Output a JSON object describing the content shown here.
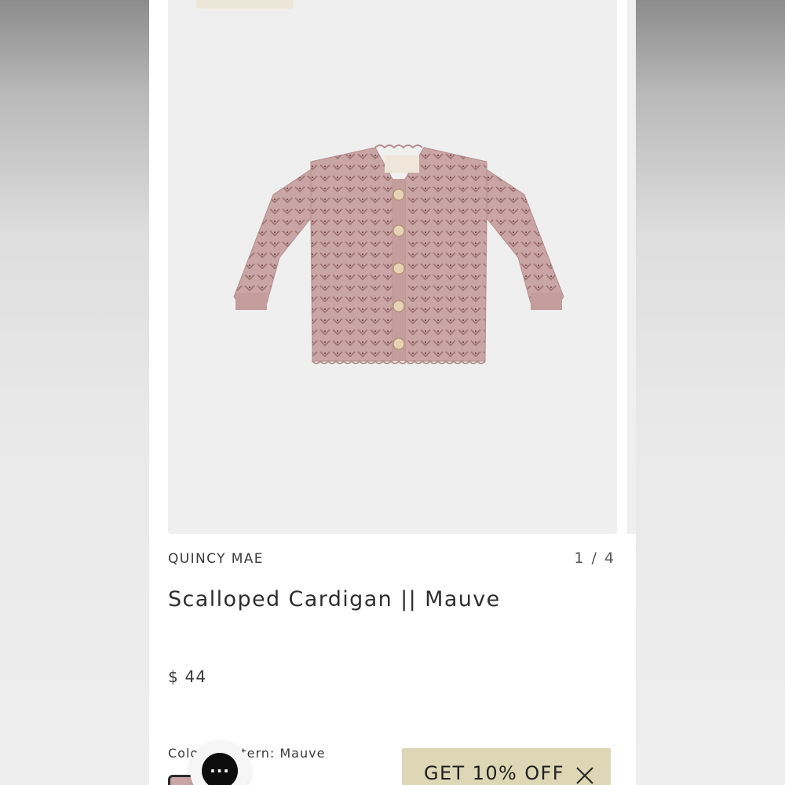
{
  "product": {
    "brand": "QUINCY MAE",
    "title": "Scalloped Cardigan || Mauve",
    "price": "$ 44",
    "image_counter": "1 / 4",
    "color_label": "Color / Pattern: Mauve",
    "garment_color": "#c9a5a5"
  },
  "chat": {
    "icon": "chat-dots-icon",
    "glyph": "···"
  },
  "promo": {
    "label": "GET 10% OFF",
    "close_icon": "close-icon",
    "bg": "#ded7b6"
  }
}
